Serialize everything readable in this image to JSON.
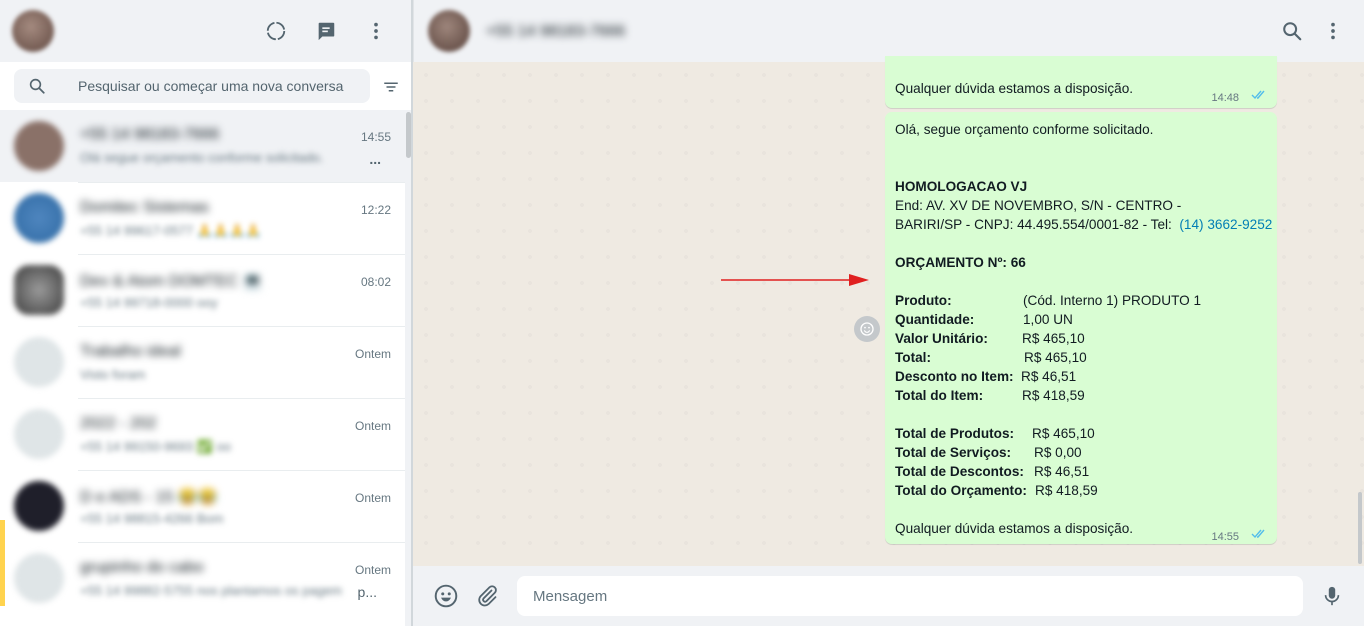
{
  "sidebar": {
    "header": {
      "icons": [
        "status-icon",
        "new-chat-icon",
        "menu-icon"
      ]
    },
    "search": {
      "placeholder": "Pesquisar ou começar uma nova conversa"
    },
    "chats": [
      {
        "name": "+55 14 98183-7666",
        "preview": "Olá segue orçamento conforme solicitado.",
        "time": "14:55",
        "ellipsis": "...",
        "avatar_color": "#8a7168"
      },
      {
        "name": "Domitec Sistemas",
        "preview": "+55 14 99617-0577 🙏🙏🙏🙏",
        "time": "12:22",
        "avatar_color": "#2f6aa3"
      },
      {
        "name": "Dev & Atom DOMTEC 💻",
        "preview": "+55 14 99718-0000 ooy",
        "time": "08:02",
        "avatar_color": "#5a5a5a"
      },
      {
        "name": "Trabalho ideal",
        "preview": "Visto foram",
        "time": "Ontem",
        "avatar_color": "#dfe5e7"
      },
      {
        "name": "2022 - 202",
        "preview": "+55 14 99150-9693 ✅ oo",
        "time": "Ontem",
        "avatar_color": "#dfe5e7"
      },
      {
        "name": "D e ADS - 15 😂😂",
        "preview": "+55 14 98815-4266 Bom",
        "time": "Ontem",
        "avatar_color": "#1f1f2a"
      },
      {
        "name": "grupinho do cabo",
        "preview": "+55 14 99882-5755 nos plantamos os pagem",
        "time": "Ontem",
        "ellipsis": "p...",
        "avatar_color": "#dfe5e7"
      }
    ]
  },
  "conversation": {
    "contact_name": "+55 14 98183-7666",
    "messages": [
      {
        "closing": "Qualquer dúvida estamos a disposição.",
        "time": "14:48"
      },
      {
        "greeting": "Olá, segue orçamento conforme solicitado.",
        "company": "HOMOLOGACAO VJ",
        "address_line1": "End: AV. XV DE NOVEMBRO, S/N - CENTRO -",
        "address_line2": "BARIRI/SP - CNPJ: 44.495.554/0001-82 - Tel:",
        "phone": "(14) 3662-9252",
        "quote_number": "ORÇAMENTO Nº: 66",
        "items": [
          {
            "label": "Produto:",
            "value": "(Cód. Interno 1) PRODUTO 1"
          },
          {
            "label": "Quantidade:",
            "value": "1,00 UN"
          },
          {
            "label": "Valor Unitário:",
            "value": "R$ 465,10"
          },
          {
            "label": "Total:",
            "value": "R$ 465,10"
          },
          {
            "label": "Desconto no Item:",
            "value": "R$ 46,51"
          },
          {
            "label": "Total do Item:",
            "value": "R$ 418,59"
          }
        ],
        "totals": [
          {
            "label": "Total de Produtos:",
            "value": "R$ 465,10"
          },
          {
            "label": "Total de Serviços:",
            "value": "R$ 0,00"
          },
          {
            "label": "Total de Descontos:",
            "value": "R$ 46,51"
          },
          {
            "label": "Total do Orçamento:",
            "value": "R$ 418,59"
          }
        ],
        "closing": "Qualquer dúvida estamos a disposição.",
        "time": "14:55"
      }
    ]
  },
  "composer": {
    "placeholder": "Mensagem"
  },
  "colors": {
    "outgoing_bubble": "#d9fdd3",
    "chat_background": "#efeae2",
    "panel_header": "#f0f2f5",
    "read_ticks": "#53bdeb",
    "annotation_arrow": "#e02020",
    "link": "#027eb5"
  }
}
